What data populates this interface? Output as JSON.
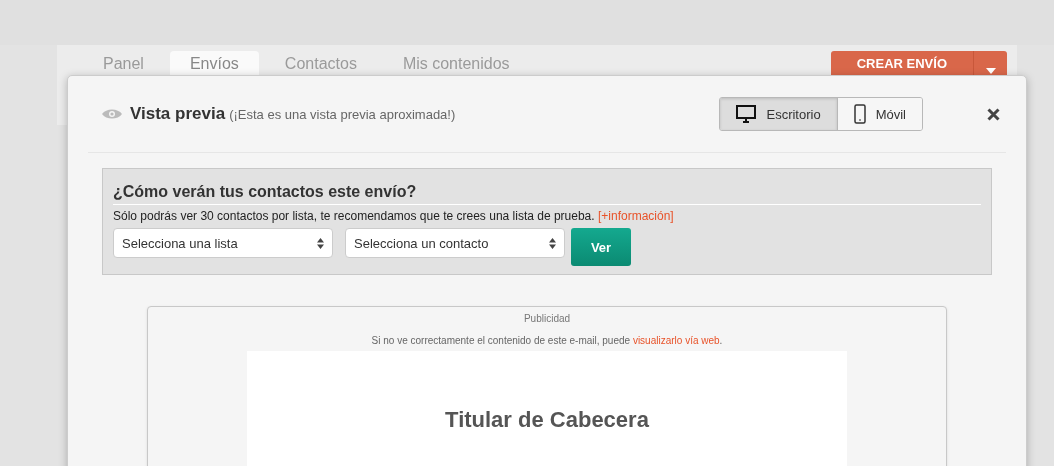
{
  "nav": {
    "tabs": [
      {
        "label": "Panel",
        "selected": false
      },
      {
        "label": "Envíos",
        "selected": true
      },
      {
        "label": "Contactos",
        "selected": false
      },
      {
        "label": "Mis contenidos",
        "selected": false
      }
    ],
    "create_button": "CREAR ENVÍO"
  },
  "modal": {
    "title": "Vista previa",
    "subtitle": "(¡Esta es una vista previa aproximada!)",
    "view_toggle": [
      {
        "label": "Escritorio",
        "kind": "desktop",
        "selected": true
      },
      {
        "label": "Móvil",
        "kind": "mobile",
        "selected": false
      }
    ]
  },
  "contacts_panel": {
    "heading": "¿Cómo verán tus contactos este envío?",
    "note": "Sólo podrás ver 30 contactos por lista, te recomendamos que te crees una lista de prueba.",
    "note_link": "[+información]",
    "selects": [
      {
        "value": "Selecciona una lista"
      },
      {
        "value": "Selecciona un contacto"
      }
    ],
    "view_button": "Ver"
  },
  "preview": {
    "ad_label": "Publicidad",
    "notice": "Si no ve correctamente el contenido de este e-mail, puede",
    "notice_link": "visualizarlo vía web",
    "notice_end": ".",
    "headline": "Titular de Cabecera"
  }
}
